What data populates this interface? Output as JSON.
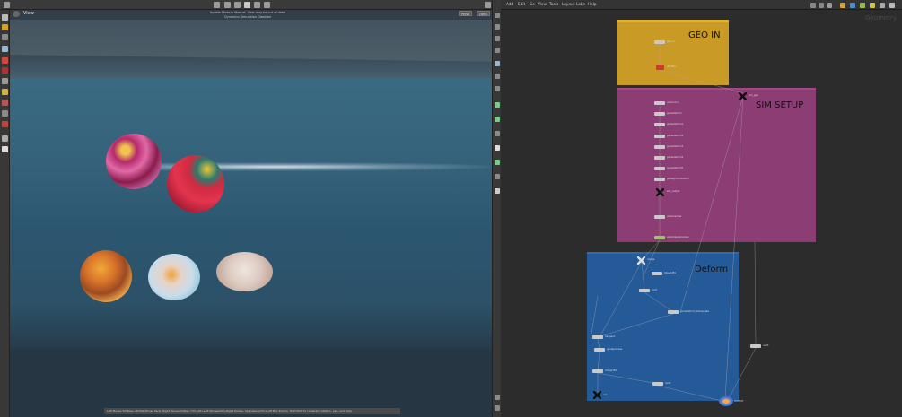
{
  "viewport": {
    "title": "View",
    "message_line1": "Update Mode is Manual. View may be out of date.",
    "message_line2": "Dynamics Simulation Disabled",
    "persp_button": "Persp",
    "cam_button": "cam1",
    "status_text": "Left Mouse Tumbles, Middle Mouse Pans, Right Mouse Dollies. Ctrl+Alt+Left Mouse/Ctrl+Right Dollies. Spacebar+Ctrl+Left Box Zooms. Hold Shift to constrain rotation, pan, and dolly."
  },
  "network": {
    "menu": [
      "Add",
      "Edit",
      "Go",
      "View",
      "Tools",
      "Layout",
      "Labs",
      "Help"
    ],
    "context_label": "Geometry",
    "boxes": [
      {
        "label": "GEO IN",
        "color": "#c99a25",
        "header": "#e0b22e"
      },
      {
        "label": "SIM SETUP",
        "color": "#8c3d74",
        "header": "#a04888"
      },
      {
        "label": "Deform",
        "color": "#255a98",
        "header": "#2e6bb0"
      }
    ]
  }
}
